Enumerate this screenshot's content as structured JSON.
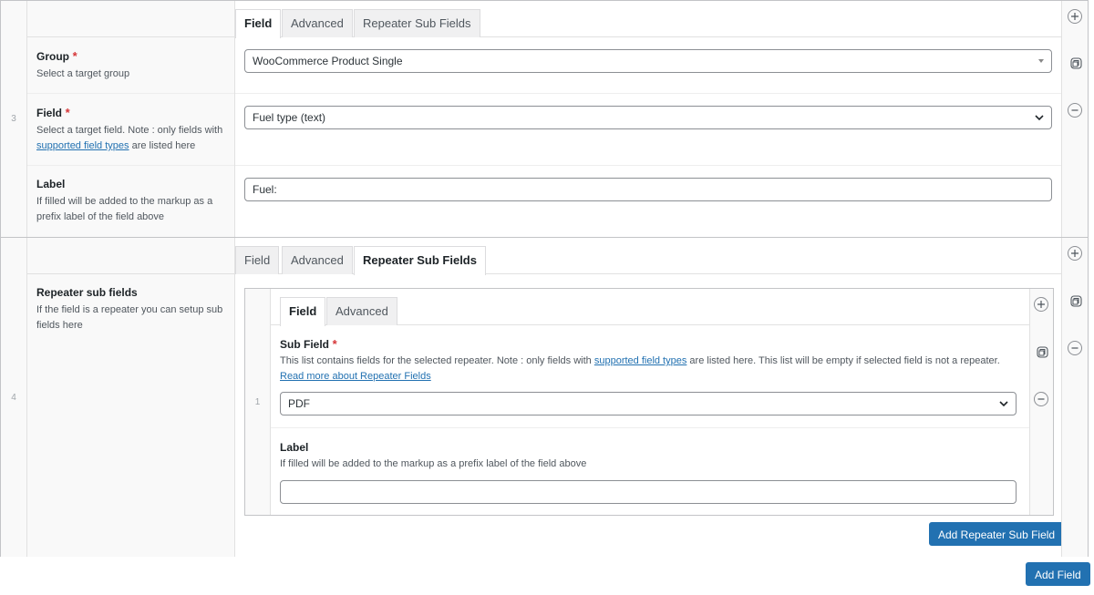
{
  "rows": [
    {
      "order": "3",
      "tabs": [
        "Field",
        "Advanced",
        "Repeater Sub Fields"
      ],
      "active_tab": "Field",
      "group": {
        "title": "Group",
        "required_mark": "*",
        "desc": "Select a target group",
        "value": "WooCommerce Product Single"
      },
      "field": {
        "title": "Field",
        "required_mark": "*",
        "desc_prefix": "Select a target field. Note : only fields with",
        "desc_link": "supported field types",
        "desc_suffix": "are listed here",
        "value": "Fuel type (text)"
      },
      "label": {
        "title": "Label",
        "desc": "If filled will be added to the markup as a prefix label of the field above",
        "value": "Fuel:"
      }
    },
    {
      "order": "4",
      "tabs": [
        "Field",
        "Advanced",
        "Repeater Sub Fields"
      ],
      "active_tab": "Repeater Sub Fields",
      "repeater": {
        "title": "Repeater sub fields",
        "desc": "If the field is a repeater you can setup sub fields here"
      },
      "sub_rows": [
        {
          "order": "1",
          "tabs": [
            "Field",
            "Advanced"
          ],
          "active_tab": "Field",
          "sub_field": {
            "title": "Sub Field",
            "required_mark": "*",
            "desc_prefix": "This list contains fields for the selected repeater. Note : only fields with",
            "desc_link": "supported field types",
            "desc_suffix": "are listed here. This list will be empty if selected field is not a repeater.",
            "read_more": "Read more about Repeater Fields",
            "value": "PDF"
          },
          "label": {
            "title": "Label",
            "desc": "If filled will be added to the markup as a prefix label of the field above",
            "value": ""
          }
        }
      ],
      "add_sub_button": "Add Repeater Sub Field"
    }
  ],
  "add_field_button": "Add Field",
  "icons": {
    "add": "plus-circle-icon",
    "duplicate": "duplicate-icon",
    "remove": "minus-circle-icon",
    "dropdown": "chevron-down-icon"
  },
  "colors": {
    "primary": "#2271b1",
    "required": "#d63638",
    "border": "#c3c4c7"
  }
}
